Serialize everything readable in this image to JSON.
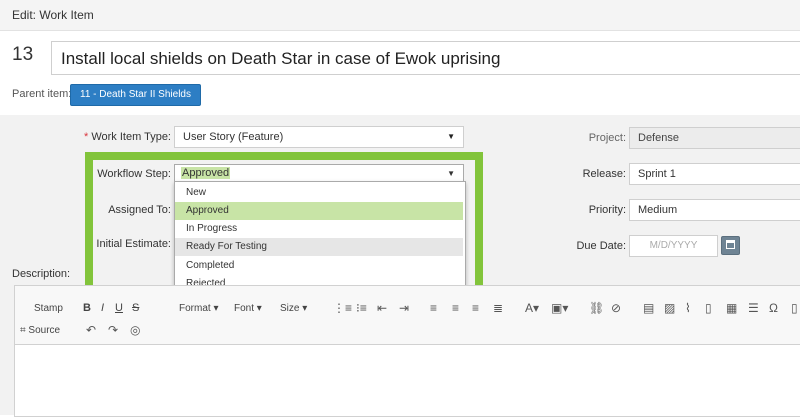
{
  "header": {
    "title": "Edit: Work Item"
  },
  "item": {
    "id": "13",
    "title": "Install local shields on Death Star in case of Ewok uprising"
  },
  "parent": {
    "label": "Parent item:",
    "value": "11 - Death Star II Shields"
  },
  "form": {
    "work_item_type": {
      "label": "Work Item Type:",
      "value": "User Story (Feature)"
    },
    "workflow_step": {
      "label": "Workflow Step:",
      "value": "Approved",
      "options": [
        "New",
        "Approved",
        "In Progress",
        "Ready For Testing",
        "Completed",
        "Rejected"
      ]
    },
    "assigned_to": {
      "label": "Assigned To:"
    },
    "initial_estimate": {
      "label": "Initial Estimate:"
    },
    "project": {
      "label": "Project:",
      "value": "Defense"
    },
    "release": {
      "label": "Release:",
      "value": "Sprint 1"
    },
    "priority": {
      "label": "Priority:",
      "value": "Medium"
    },
    "due_date": {
      "label": "Due Date:",
      "placeholder": "M/D/YYYY"
    }
  },
  "description": {
    "label": "Description:",
    "toolbar": {
      "stamp": "Stamp",
      "format": "Format",
      "font": "Font",
      "size": "Size",
      "source": "Source"
    }
  },
  "colors": {
    "accent": "#2d7ec4",
    "highlight": "#82c43b",
    "selected_option": "#c8e4a6"
  }
}
